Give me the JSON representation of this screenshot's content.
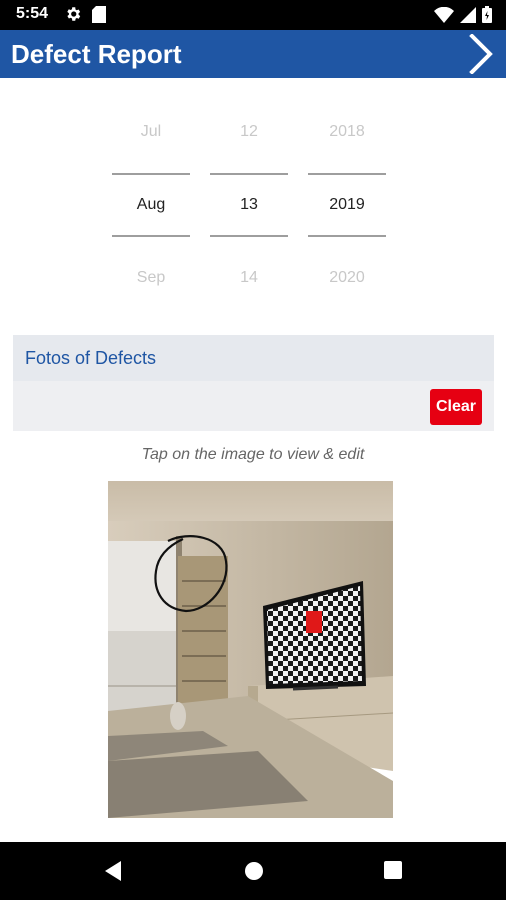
{
  "status": {
    "time": "5:54"
  },
  "appbar": {
    "title": "Defect Report"
  },
  "date_picker": {
    "month": {
      "prev": "Jul",
      "current": "Aug",
      "next": "Sep"
    },
    "day": {
      "prev": "12",
      "current": "13",
      "next": "14"
    },
    "year": {
      "prev": "2018",
      "current": "2019",
      "next": "2020"
    }
  },
  "photos": {
    "title": "Fotos of Defects",
    "clear_label": "Clear",
    "hint": "Tap on the image to view & edit"
  },
  "colors": {
    "accent": "#1f56a4",
    "clear": "#e60012"
  }
}
